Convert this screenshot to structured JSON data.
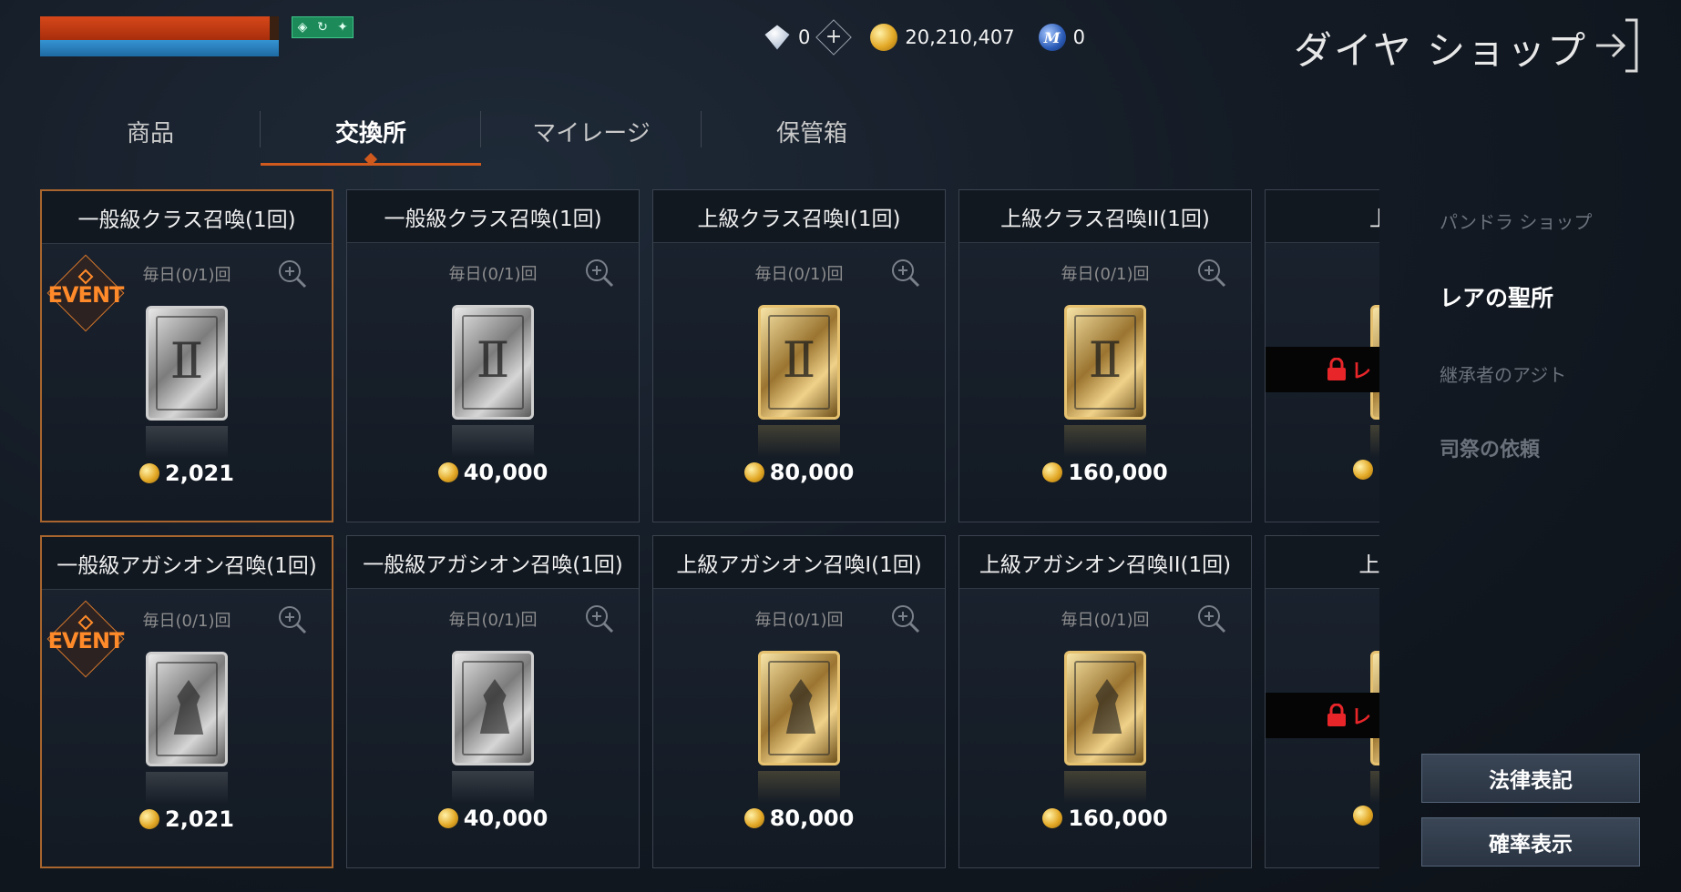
{
  "status": {
    "hp_pct": 96,
    "mp_pct": 100
  },
  "currencies": {
    "diamond": "0",
    "gold": "20,210,407",
    "mileage": "0"
  },
  "header": {
    "title": "ダイヤ ショップ"
  },
  "tabs": [
    {
      "label": "商品"
    },
    {
      "label": "交換所"
    },
    {
      "label": "マイレージ"
    },
    {
      "label": "保管箱"
    }
  ],
  "rows": [
    {
      "cards": [
        {
          "title": "一般級クラス召喚(1回)",
          "daily": "毎日(0/1)回",
          "price": "2,021",
          "event": "EVENT",
          "tier": "silver",
          "kind": "class"
        },
        {
          "title": "一般級クラス召喚(1回)",
          "daily": "毎日(0/1)回",
          "price": "40,000",
          "tier": "silver",
          "kind": "class"
        },
        {
          "title": "上級クラス召喚I(1回)",
          "daily": "毎日(0/1)回",
          "price": "80,000",
          "tier": "gold",
          "kind": "class"
        },
        {
          "title": "上級クラス召喚II(1回)",
          "daily": "毎日(0/1)回",
          "price": "160,000",
          "tier": "gold",
          "kind": "class"
        },
        {
          "title": "上級クラ",
          "lock": "レ",
          "tier": "gold",
          "kind": "class"
        }
      ]
    },
    {
      "cards": [
        {
          "title": "一般級アガシオン召喚(1回)",
          "daily": "毎日(0/1)回",
          "price": "2,021",
          "event": "EVENT",
          "tier": "silver",
          "kind": "agathion"
        },
        {
          "title": "一般級アガシオン召喚(1回)",
          "daily": "毎日(0/1)回",
          "price": "40,000",
          "tier": "silver",
          "kind": "agathion"
        },
        {
          "title": "上級アガシオン召喚I(1回)",
          "daily": "毎日(0/1)回",
          "price": "80,000",
          "tier": "gold",
          "kind": "agathion"
        },
        {
          "title": "上級アガシオン召喚II(1回)",
          "daily": "毎日(0/1)回",
          "price": "160,000",
          "tier": "gold",
          "kind": "agathion"
        },
        {
          "title": "上級アガシ",
          "lock": "レ",
          "tier": "gold",
          "kind": "agathion"
        }
      ]
    }
  ],
  "side_menu": [
    {
      "label": "パンドラ ショップ"
    },
    {
      "label": "レアの聖所"
    },
    {
      "label": "継承者のアジト"
    },
    {
      "label": "司祭の依頼"
    }
  ],
  "buttons": {
    "legal": "法律表記",
    "probability": "確率表示"
  },
  "icons": {
    "diamond": "diamond-icon",
    "gold": "gold-coin-icon",
    "mileage": "mileage-m-icon",
    "zoom": "zoom-in-icon",
    "lock": "lock-icon",
    "exit": "exit-arrow-icon"
  },
  "colors": {
    "accent": "#d05a1e",
    "event": "#ff8a2a",
    "lock_red": "#e8262a"
  }
}
